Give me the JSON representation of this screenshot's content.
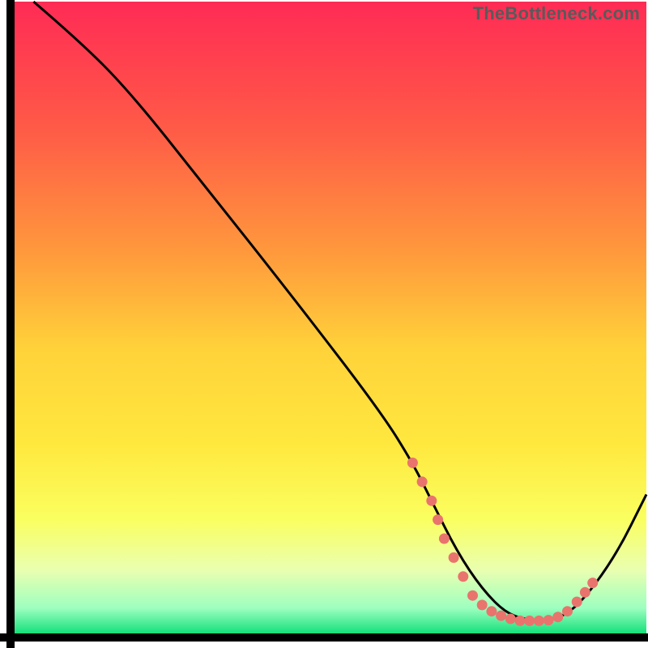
{
  "watermark": "TheBottleneck.com",
  "chart_data": {
    "type": "line",
    "title": "",
    "xlabel": "",
    "ylabel": "",
    "xlim": [
      0,
      100
    ],
    "ylim": [
      0,
      100
    ],
    "background_gradient": {
      "stops": [
        {
          "offset": 0,
          "color": "#ff2b55"
        },
        {
          "offset": 20,
          "color": "#ff5a47"
        },
        {
          "offset": 40,
          "color": "#ff9a3c"
        },
        {
          "offset": 55,
          "color": "#ffd23a"
        },
        {
          "offset": 70,
          "color": "#ffe83e"
        },
        {
          "offset": 82,
          "color": "#faff60"
        },
        {
          "offset": 90,
          "color": "#e9ffb0"
        },
        {
          "offset": 96,
          "color": "#9dffc0"
        },
        {
          "offset": 100,
          "color": "#15e07a"
        }
      ]
    },
    "series": [
      {
        "name": "bottleneck-curve",
        "color": "#000000",
        "x": [
          3,
          10,
          18,
          30,
          45,
          58,
          63,
          66,
          70,
          74,
          78,
          82,
          85,
          89,
          95,
          100
        ],
        "y": [
          100,
          94,
          86,
          71,
          52,
          35,
          27,
          21,
          13,
          7,
          3,
          2,
          2,
          4,
          12,
          22
        ]
      }
    ],
    "flat_zone_markers": {
      "color": "#e9746d",
      "points": [
        {
          "x": 63,
          "y": 27
        },
        {
          "x": 64.5,
          "y": 24
        },
        {
          "x": 66,
          "y": 21
        },
        {
          "x": 67,
          "y": 18
        },
        {
          "x": 68,
          "y": 15
        },
        {
          "x": 69.5,
          "y": 12
        },
        {
          "x": 71,
          "y": 9
        },
        {
          "x": 72.5,
          "y": 6
        },
        {
          "x": 74,
          "y": 4.5
        },
        {
          "x": 75.5,
          "y": 3.5
        },
        {
          "x": 77,
          "y": 2.8
        },
        {
          "x": 78.5,
          "y": 2.3
        },
        {
          "x": 80,
          "y": 2.0
        },
        {
          "x": 81.5,
          "y": 2.0
        },
        {
          "x": 83,
          "y": 2.0
        },
        {
          "x": 84.5,
          "y": 2.1
        },
        {
          "x": 86,
          "y": 2.6
        },
        {
          "x": 87.5,
          "y": 3.5
        },
        {
          "x": 89,
          "y": 5.0
        },
        {
          "x": 90.3,
          "y": 6.5
        },
        {
          "x": 91.5,
          "y": 8.0
        }
      ]
    }
  }
}
